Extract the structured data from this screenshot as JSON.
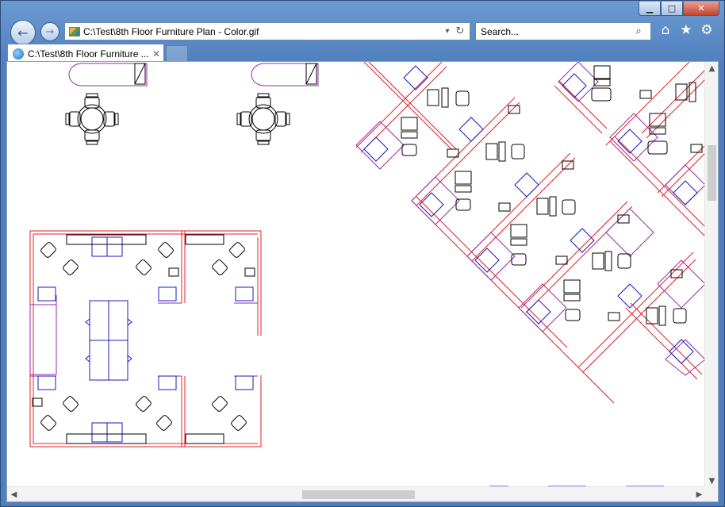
{
  "window": {
    "minimize_glyph": "▁",
    "maximize_glyph": "□",
    "close_glyph": "✕"
  },
  "nav": {
    "back_glyph": "←",
    "forward_glyph": "→"
  },
  "address": {
    "url": "C:\\Test\\8th Floor Furniture Plan - Color.gif",
    "dropdown_glyph": "▾",
    "refresh_glyph": "↻"
  },
  "search": {
    "placeholder": "Search...",
    "icon_glyph": "⌕",
    "dropdown_glyph": "▾"
  },
  "toolbar": {
    "home_glyph": "⌂",
    "favorites_glyph": "★",
    "tools_glyph": "⚙"
  },
  "tab": {
    "label": "C:\\Test\\8th Floor Furniture ...",
    "close_glyph": "✕"
  },
  "scrollbars": {
    "up_glyph": "▲",
    "down_glyph": "▼",
    "left_glyph": "◀",
    "right_glyph": "▶"
  },
  "colors": {
    "wall": "#e0202a",
    "partition": "#9a2aa8",
    "furniture": "#1818c0",
    "fixture": "#000000"
  }
}
